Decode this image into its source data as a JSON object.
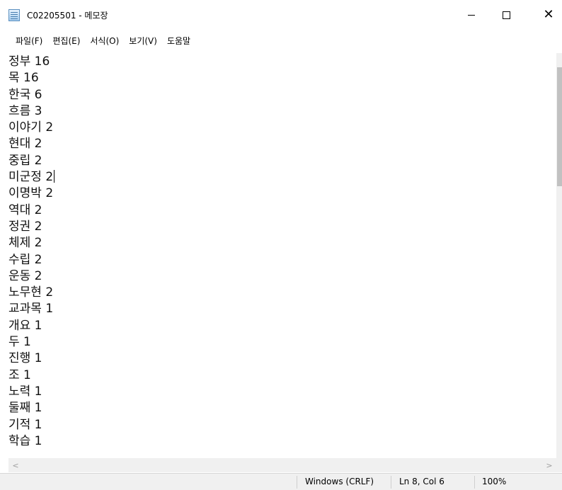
{
  "window": {
    "title": "C02205501 - 메모장",
    "minimize_label": "",
    "maximize_label": "",
    "close_label": "✕"
  },
  "menu": {
    "items": [
      {
        "label": "파일(F)"
      },
      {
        "label": "편집(E)"
      },
      {
        "label": "서식(O)"
      },
      {
        "label": "보기(V)"
      },
      {
        "label": "도움말"
      }
    ]
  },
  "editor": {
    "lines": [
      "정부 16",
      "목 16",
      "한국 6",
      "흐름 3",
      "이야기 2",
      "현대 2",
      "중립 2",
      "미군정 2",
      "이명박 2",
      "역대 2",
      "정권 2",
      "체제 2",
      "수립 2",
      "운동 2",
      "노무현 2",
      "교과목 1",
      "개요 1",
      "두 1",
      "진행 1",
      "조 1",
      "노력 1",
      "둘째 1",
      "기적 1",
      "학습 1"
    ]
  },
  "scrollbar": {
    "left_arrow": "<",
    "right_arrow": ">"
  },
  "status": {
    "line_ending": "Windows (CRLF)",
    "position": "Ln 8, Col 6",
    "zoom": "100%"
  }
}
